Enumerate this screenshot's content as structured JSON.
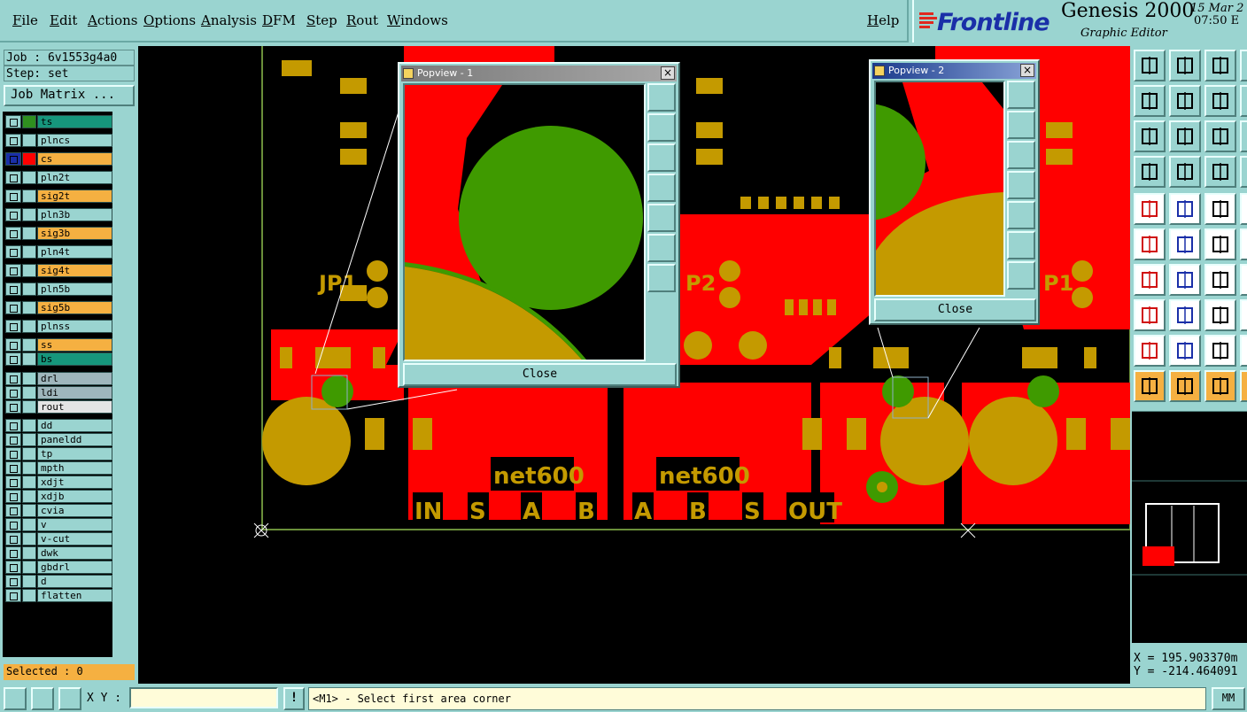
{
  "menu": {
    "items": [
      "File",
      "Edit",
      "Actions",
      "Options",
      "Analysis",
      "DFM",
      "Step",
      "Rout",
      "Windows"
    ],
    "help": "Help"
  },
  "brand": {
    "logo_text": "Frontline",
    "product": "Genesis 2000",
    "subtitle": "Graphic Editor",
    "date": "15 Mar 2",
    "time": "07:50 E"
  },
  "left": {
    "job": "Job : 6v1553g4a0",
    "step": "Step: set",
    "job_matrix": "Job Matrix ...",
    "selected": "Selected : 0",
    "layers": [
      {
        "name": "ts",
        "color": "#16967c",
        "swatch": "#2f8f1f"
      },
      {
        "name": "plncs",
        "color": "#9ad4d0",
        "swatch": "#9ad4d0"
      },
      {
        "name": "cs",
        "color": "#f5b041",
        "swatch": "#ff0000",
        "active": true
      },
      {
        "name": "pln2t",
        "color": "#9ad4d0",
        "swatch": "#9ad4d0"
      },
      {
        "name": "sig2t",
        "color": "#f5b041",
        "swatch": "#9ad4d0"
      },
      {
        "name": "pln3b",
        "color": "#9ad4d0",
        "swatch": "#9ad4d0"
      },
      {
        "name": "sig3b",
        "color": "#f5b041",
        "swatch": "#9ad4d0"
      },
      {
        "name": "pln4t",
        "color": "#9ad4d0",
        "swatch": "#9ad4d0"
      },
      {
        "name": "sig4t",
        "color": "#f5b041",
        "swatch": "#9ad4d0"
      },
      {
        "name": "pln5b",
        "color": "#9ad4d0",
        "swatch": "#9ad4d0"
      },
      {
        "name": "sig5b",
        "color": "#f5b041",
        "swatch": "#9ad4d0"
      },
      {
        "name": "plnss",
        "color": "#9ad4d0",
        "swatch": "#9ad4d0"
      },
      {
        "name": "ss",
        "color": "#f5b041",
        "swatch": "#9ad4d0"
      },
      {
        "name": "bs",
        "color": "#16967c",
        "swatch": "#9ad4d0"
      },
      {
        "name": "drl",
        "color": "#9fb6bc",
        "swatch": "#9ad4d0"
      },
      {
        "name": "ldi",
        "color": "#9fb6bc",
        "swatch": "#9ad4d0"
      },
      {
        "name": "rout",
        "color": "#e4e4e4",
        "swatch": "#9ad4d0"
      },
      {
        "name": "dd",
        "color": "#9ad4d0",
        "swatch": "#9ad4d0"
      },
      {
        "name": "paneldd",
        "color": "#9ad4d0",
        "swatch": "#9ad4d0"
      },
      {
        "name": "tp",
        "color": "#9ad4d0",
        "swatch": "#9ad4d0"
      },
      {
        "name": "mpth",
        "color": "#9ad4d0",
        "swatch": "#9ad4d0"
      },
      {
        "name": "xdjt",
        "color": "#9ad4d0",
        "swatch": "#9ad4d0"
      },
      {
        "name": "xdjb",
        "color": "#9ad4d0",
        "swatch": "#9ad4d0"
      },
      {
        "name": "cvia",
        "color": "#9ad4d0",
        "swatch": "#9ad4d0"
      },
      {
        "name": "v",
        "color": "#9ad4d0",
        "swatch": "#9ad4d0"
      },
      {
        "name": "v-cut",
        "color": "#9ad4d0",
        "swatch": "#9ad4d0"
      },
      {
        "name": "dwk",
        "color": "#9ad4d0",
        "swatch": "#9ad4d0"
      },
      {
        "name": "gbdrl",
        "color": "#9ad4d0",
        "swatch": "#9ad4d0"
      },
      {
        "name": "d",
        "color": "#9ad4d0",
        "swatch": "#9ad4d0"
      },
      {
        "name": "flatten",
        "color": "#9ad4d0",
        "swatch": "#9ad4d0"
      }
    ]
  },
  "canvas": {
    "labels": {
      "jp1": "JP1",
      "jp2": "P2",
      "jp3": "P1",
      "net_left": "net600",
      "net_right": "net600",
      "in": "IN",
      "s1": "S",
      "a1": "A",
      "b1": "B",
      "a2": "A",
      "b2": "B",
      "s2": "S",
      "out": "OUT"
    },
    "colors": {
      "copper": "#ff0000",
      "pad": "#c49a00",
      "mask": "#3f9a00",
      "outline": "#6a8f3a"
    }
  },
  "popview1": {
    "title": "Popview - 1",
    "close": "Close"
  },
  "popview2": {
    "title": "Popview - 2",
    "close": "Close"
  },
  "right": {
    "x": "X = 195.903370m",
    "y": "Y = -214.464091"
  },
  "bottom": {
    "xy_label": "X Y :",
    "xy_value": "",
    "warn": "!",
    "status": "<M1> - Select first area corner",
    "units": "MM"
  }
}
